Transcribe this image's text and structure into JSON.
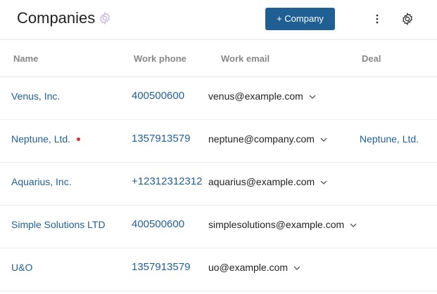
{
  "header": {
    "title": "Companies",
    "add_button_label": "+ Company"
  },
  "columns": {
    "name": "Name",
    "work_phone": "Work phone",
    "work_email": "Work email",
    "deal": "Deal"
  },
  "rows": [
    {
      "name": "Venus, Inc.",
      "phone": "400500600",
      "email": "venus@example.com",
      "deal": "",
      "flag": false
    },
    {
      "name": "Neptune, Ltd.",
      "phone": "1357913579",
      "email": "neptune@company.com",
      "deal": "Neptune, Ltd.",
      "flag": true
    },
    {
      "name": "Aquarius, Inc.",
      "phone": "+12312312312",
      "email": "aquarius@example.com",
      "deal": "",
      "flag": false
    },
    {
      "name": "Simple Solutions LTD",
      "phone": "400500600",
      "email": "simplesolutions@example.com",
      "deal": "",
      "flag": false
    },
    {
      "name": "U&O",
      "phone": "1357913579",
      "email": "uo@example.com",
      "deal": "",
      "flag": false
    }
  ],
  "colors": {
    "accent": "#1f5f94",
    "flag": "#d32f2f"
  },
  "icons": {
    "title_settings": "gear-icon",
    "more": "more-vertical-icon",
    "settings": "gear-icon",
    "email_dropdown": "chevron-down-icon",
    "flag": "red-dot-indicator"
  }
}
